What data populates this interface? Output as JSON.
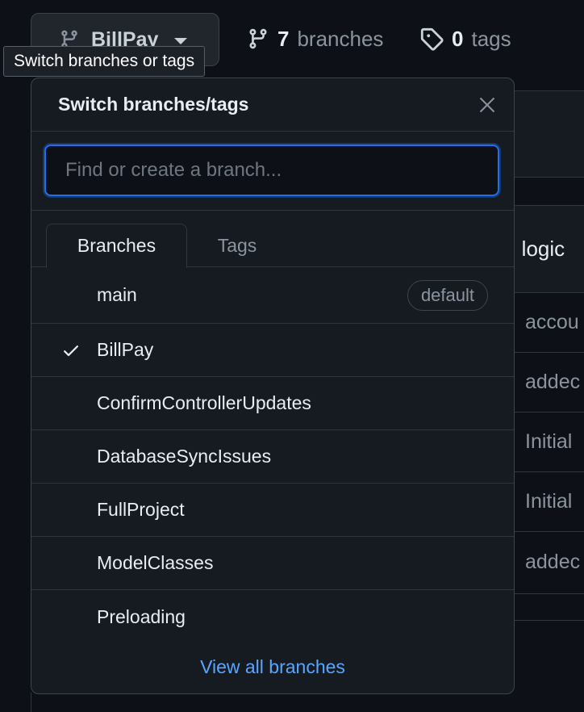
{
  "repo_bar": {
    "current_branch": "BillPay",
    "branches_count": "7",
    "branches_label": "branches",
    "tags_count": "0",
    "tags_label": "tags"
  },
  "tooltip": "Switch branches or tags",
  "background": {
    "header_fragment": "n logic",
    "rows": [
      "accou",
      "addec",
      "Initial",
      "Initial",
      "addec"
    ]
  },
  "dropdown": {
    "title": "Switch branches/tags",
    "filter_placeholder": "Find or create a branch...",
    "filter_value": "",
    "tabs": [
      {
        "label": "Branches",
        "active": true
      },
      {
        "label": "Tags",
        "active": false
      }
    ],
    "branches": [
      {
        "name": "main",
        "badge": "default",
        "selected": false
      },
      {
        "name": "BillPay",
        "badge": "",
        "selected": true
      },
      {
        "name": "ConfirmControllerUpdates",
        "badge": "",
        "selected": false
      },
      {
        "name": "DatabaseSyncIssues",
        "badge": "",
        "selected": false
      },
      {
        "name": "FullProject",
        "badge": "",
        "selected": false
      },
      {
        "name": "ModelClasses",
        "badge": "",
        "selected": false
      },
      {
        "name": "Preloading",
        "badge": "",
        "selected": false
      }
    ],
    "view_all_label": "View all branches"
  },
  "icons": {
    "branch": "git-branch-icon",
    "tag": "tag-icon",
    "close": "close-icon",
    "check": "check-icon"
  },
  "colors": {
    "background": "#0d1117",
    "panel": "#161b22",
    "accent": "#1f6feb",
    "link": "#58a6ff",
    "muted": "#8b949e"
  }
}
